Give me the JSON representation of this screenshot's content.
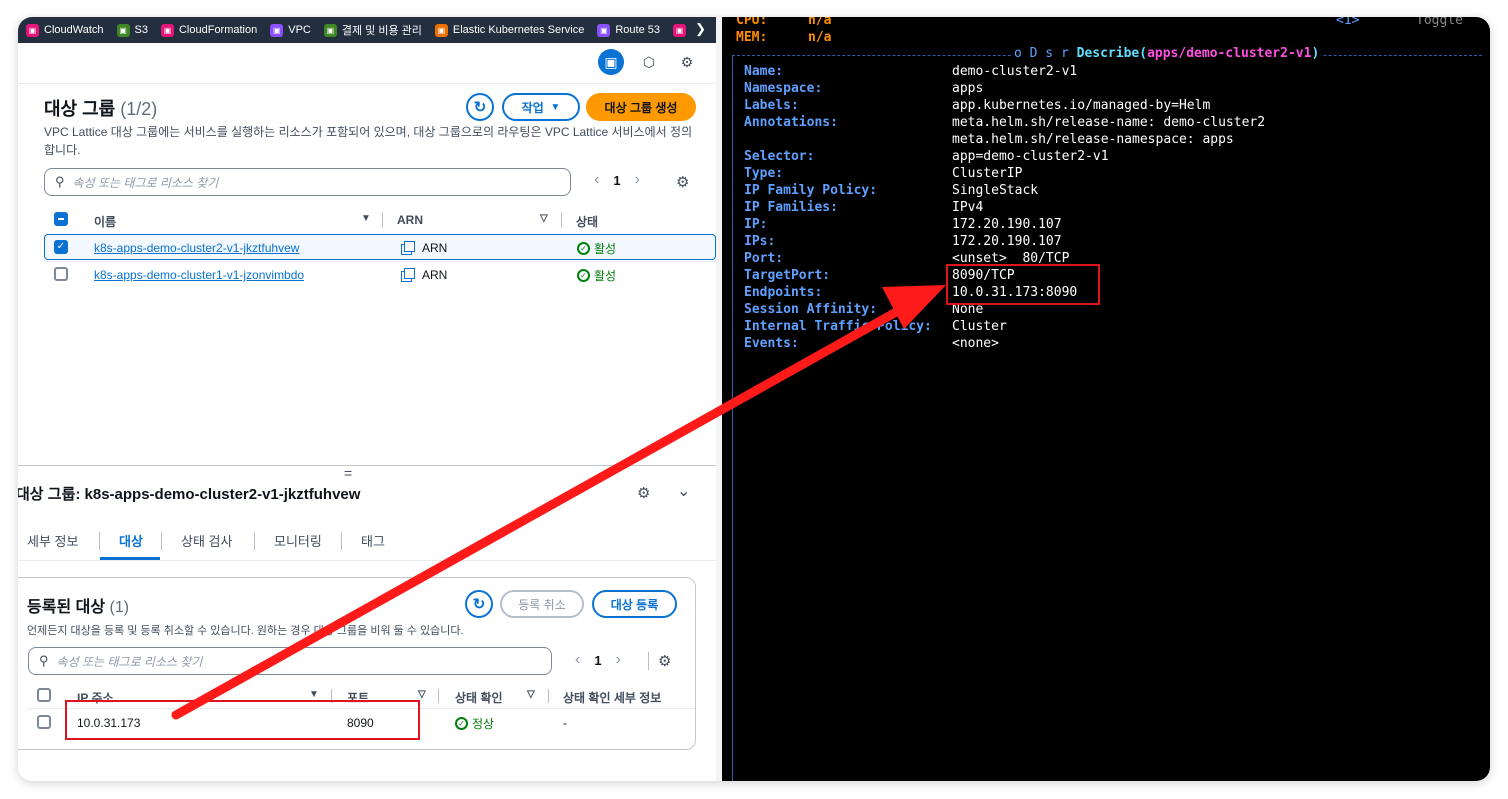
{
  "bookmarks": [
    {
      "label": "CloudWatch",
      "color": "#e7157b"
    },
    {
      "label": "S3",
      "color": "#3f8624"
    },
    {
      "label": "CloudFormation",
      "color": "#e7157b"
    },
    {
      "label": "VPC",
      "color": "#8c4fff"
    },
    {
      "label": "결제 및 비용 관리",
      "color": "#3f8624"
    },
    {
      "label": "Elastic Kubernetes Service",
      "color": "#ed7100"
    },
    {
      "label": "Route 53",
      "color": "#8c4fff"
    }
  ],
  "target_groups": {
    "title": "대상 그룹",
    "count": "(1/2)",
    "description": "VPC Lattice 대상 그룹에는 서비스를 실행하는 리소스가 포함되어 있으며, 대상 그룹으로의 라우팅은 VPC Lattice 서비스에서 정의합니다.",
    "actions_label": "작업",
    "create_label": "대상 그룹 생성",
    "search_placeholder": "속성 또는 태그로 리소스 찾기",
    "page": "1",
    "columns": [
      "이름",
      "ARN",
      "상태"
    ],
    "rows": [
      {
        "name": "k8s-apps-demo-cluster2-v1-jkztfuhvew",
        "arn": "ARN",
        "status": "활성",
        "selected": true
      },
      {
        "name": "k8s-apps-demo-cluster1-v1-jzonvimbdo",
        "arn": "ARN",
        "status": "활성",
        "selected": false
      }
    ]
  },
  "resize_handle": "=",
  "detail": {
    "title": "대상 그룹: k8s-apps-demo-cluster2-v1-jkztfuhvew",
    "tabs": [
      "세부 정보",
      "대상",
      "상태 검사",
      "모니터링",
      "태그"
    ],
    "active_tab": "대상"
  },
  "registered": {
    "title": "등록된 대상",
    "count": "(1)",
    "deregister_label": "등록 취소",
    "register_label": "대상 등록",
    "description": "언제든지 대상을 등록 및 등록 취소할 수 있습니다. 원하는 경우 대상 그룹을 비워 둘 수 있습니다.",
    "search_placeholder": "속성 또는 태그로 리소스 찾기",
    "page": "1",
    "columns": [
      "IP 주소",
      "포트",
      "상태 확인",
      "상태 확인 세부 정보"
    ],
    "rows": [
      {
        "ip": "10.0.31.173",
        "port": "8090",
        "health": "정상",
        "detail": "-"
      }
    ]
  },
  "terminal": {
    "header_top": [
      {
        "key": "CPU:",
        "value": "n/a"
      },
      {
        "key": "MEM:",
        "value": "n/a"
      }
    ],
    "header_right": "<1>",
    "header_toggle": "Toggle",
    "describe_prefix": "o D s r ",
    "describe_title": "Describe(",
    "describe_target": "apps/demo-cluster2-v1",
    "describe_close": ")",
    "lines": [
      {
        "key": "Name:",
        "value": "demo-cluster2-v1"
      },
      {
        "key": "Namespace:",
        "value": "apps"
      },
      {
        "key": "Labels:",
        "value": "app.kubernetes.io/managed-by=Helm"
      },
      {
        "key": "Annotations:",
        "value": "meta.helm.sh/release-name: demo-cluster2"
      },
      {
        "key": "",
        "value": "meta.helm.sh/release-namespace: apps"
      },
      {
        "key": "Selector:",
        "value": "app=demo-cluster2-v1"
      },
      {
        "key": "Type:",
        "value": "ClusterIP"
      },
      {
        "key": "IP Family Policy:",
        "value": "SingleStack"
      },
      {
        "key": "IP Families:",
        "value": "IPv4"
      },
      {
        "key": "IP:",
        "value": "172.20.190.107"
      },
      {
        "key": "IPs:",
        "value": "172.20.190.107"
      },
      {
        "key": "Port:",
        "value": "<unset>  80/TCP"
      },
      {
        "key": "TargetPort:",
        "value": "8090/TCP"
      },
      {
        "key": "Endpoints:",
        "value": "10.0.31.173:8090"
      },
      {
        "key": "Session Affinity:",
        "value": "None"
      },
      {
        "key": "Internal Traffic Policy:",
        "value": "Cluster"
      },
      {
        "key": "Events:",
        "value": "<none>"
      }
    ]
  },
  "colors": {
    "accent": "#0972d3",
    "primary_button": "#ff9900",
    "ok": "#037f0c",
    "annotation": "#e0141e",
    "terminal_key": "#5fa0ff",
    "terminal_accent": "#ff8c00"
  }
}
